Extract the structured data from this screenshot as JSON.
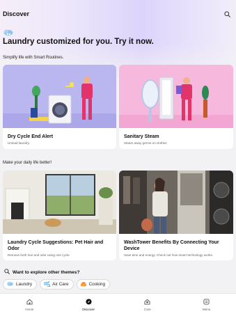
{
  "header": {
    "title": "Discover",
    "search_icon": "search-icon"
  },
  "hero": {
    "text": "Laundry customized for you. Try it now.",
    "icon": "laundry-cloud-icon"
  },
  "sections": [
    {
      "label": "Simplify life with Smart Routines."
    },
    {
      "label": "Make your daily life better!"
    }
  ],
  "cards": [
    {
      "title": "Dry Cycle End Alert",
      "subtitle": "Unload laundry.",
      "bg": "#b9b6f0"
    },
    {
      "title": "Sanitary Steam",
      "subtitle": "Steam away germs on clothes",
      "bg": "#f7b8dd"
    },
    {
      "title": "Laundry Cycle Suggestions: Pet Hair and Odor",
      "subtitle": "Remove both hair and odor using one cycle.",
      "bg": "#d9d4c8"
    },
    {
      "title": "WashTower Benefits By Connecting Your Device",
      "subtitle": "Save time and energy. Check out how smart technology works.",
      "bg": "#8f8a82"
    }
  ],
  "explore": {
    "question": "Want to explore other themes?"
  },
  "chips": [
    {
      "label": "Laundry",
      "icon": "laundry-icon"
    },
    {
      "label": "Air Care",
      "icon": "air-care-icon"
    },
    {
      "label": "Cooking",
      "icon": "cooking-icon"
    }
  ],
  "nav": [
    {
      "label": "Home",
      "icon": "home-icon"
    },
    {
      "label": "Discover",
      "icon": "compass-icon"
    },
    {
      "label": "Care",
      "icon": "care-icon"
    },
    {
      "label": "Menu",
      "icon": "menu-icon"
    }
  ]
}
